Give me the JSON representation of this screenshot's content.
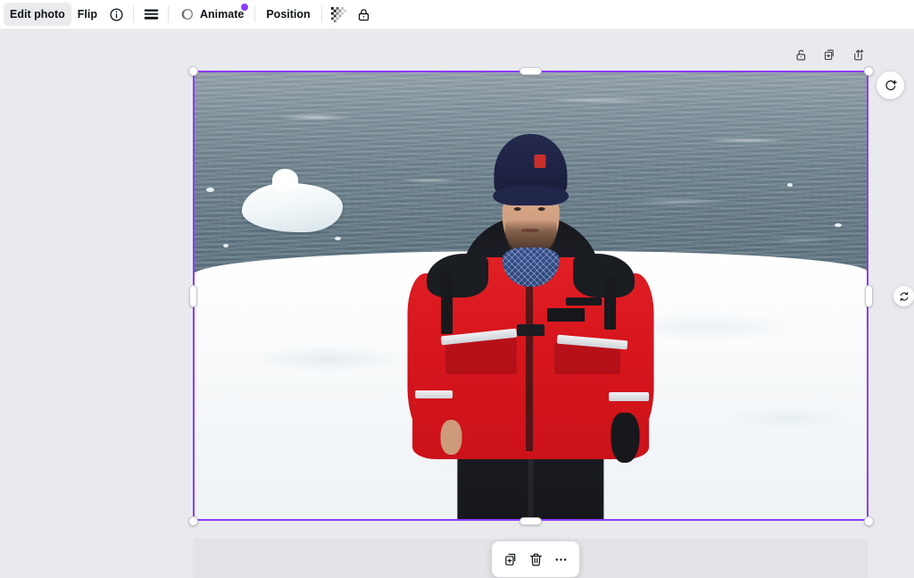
{
  "toolbar": {
    "edit_photo_label": "Edit photo",
    "flip_label": "Flip",
    "info_icon": "info-circle-icon",
    "thickness_icon": "line-weight-icon",
    "animate_label": "Animate",
    "animate_icon": "animate-circle-icon",
    "animate_badge": "new-feature-dot",
    "position_label": "Position",
    "transparency_icon": "transparency-checker-icon",
    "lock_icon": "lock-closed-icon"
  },
  "frame_tools": {
    "unlock_icon": "lock-open-icon",
    "duplicate_icon": "duplicate-plus-icon",
    "export_icon": "export-up-plus-icon"
  },
  "canvas": {
    "rotate_big_icon": "rotate-clockwise-plus-icon",
    "rotate_small_icon": "rotate-refresh-icon",
    "selection_color": "#8b3dff",
    "background_color": "#e9eaee",
    "placeholder_color": "#e3e4e8"
  },
  "float_toolbar": {
    "duplicate_icon": "duplicate-plus-icon",
    "delete_icon": "trash-can-icon",
    "more_icon": "more-horizontal-icon"
  },
  "photo": {
    "alt": "Man in red survival suit and navy beanie standing on snow with icy sea behind",
    "sea_color": "#687c87",
    "snow_color": "#ffffff",
    "suit_color": "#d8161d",
    "beanie_color": "#1e2344",
    "bandana_color": "#2f4a86"
  }
}
